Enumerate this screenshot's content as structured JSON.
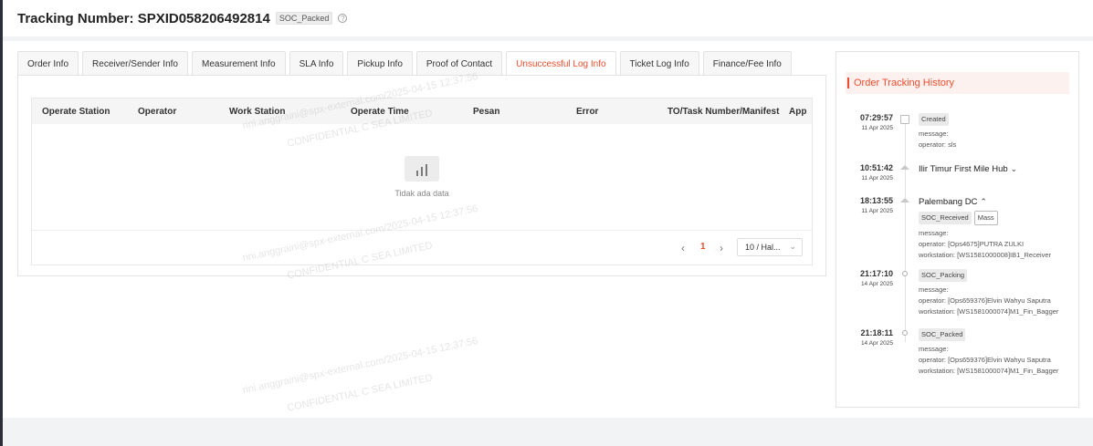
{
  "header": {
    "title": "Tracking Number: SPXID058206492814",
    "status_badge": "SOC_Packed",
    "help_icon": "?"
  },
  "tabs": [
    {
      "label": "Order Info",
      "active": false
    },
    {
      "label": "Receiver/Sender Info",
      "active": false
    },
    {
      "label": "Measurement Info",
      "active": false
    },
    {
      "label": "SLA Info",
      "active": false
    },
    {
      "label": "Pickup Info",
      "active": false
    },
    {
      "label": "Proof of Contact",
      "active": false
    },
    {
      "label": "Unsuccessful Log Info",
      "active": true
    },
    {
      "label": "Ticket Log Info",
      "active": false
    },
    {
      "label": "Finance/Fee Info",
      "active": false
    }
  ],
  "table": {
    "columns": [
      "Operate Station",
      "Operator",
      "Work Station",
      "Operate Time",
      "Pesan",
      "Error",
      "TO/Task Number/Manifest",
      "App"
    ],
    "empty_text": "Tidak ada data"
  },
  "pagination": {
    "prev": "‹",
    "current_page": "1",
    "next": "›",
    "page_size": "10 / Hal...",
    "page_size_caret": "⌄"
  },
  "history": {
    "title": "Order Tracking History",
    "events": [
      {
        "time": "07:29:57",
        "date": "11 Apr 2025",
        "status": "Created",
        "lines": [
          "message:",
          "operator: sls"
        ]
      },
      {
        "time": "10:51:42",
        "date": "11 Apr 2025",
        "location": "Ilir Timur First Mile Hub",
        "chevron": "⌄"
      },
      {
        "time": "18:13:55",
        "date": "11 Apr 2025",
        "location": "Palembang DC",
        "chevron": "⌃",
        "status": "SOC_Received",
        "status2": "Mass",
        "lines": [
          "message:",
          "operator: [Ops4675]PUTRA ZULKI",
          "workstation: [WS1581000008]IB1_Receiver"
        ]
      },
      {
        "time": "21:17:10",
        "date": "14 Apr 2025",
        "status": "SOC_Packing",
        "lines": [
          "message:",
          "operator: [Ops659376]Elvin Wahyu Saputra",
          "workstation: [WS1581000074]M1_Fin_Bagger"
        ]
      },
      {
        "time": "21:18:11",
        "date": "14 Apr 2025",
        "status": "SOC_Packed",
        "lines": [
          "message:",
          "operator: [Ops659376]Elvin Wahyu Saputra",
          "workstation: [WS1581000074]M1_Fin_Bagger"
        ]
      }
    ]
  },
  "watermark": {
    "line1": "rini.anggraini@spx-external.com/2025-04-15 12:37:56",
    "line2": "CONFIDENTIAL C SEA LIMITED"
  },
  "colors": {
    "accent": "#ee4d2d"
  }
}
